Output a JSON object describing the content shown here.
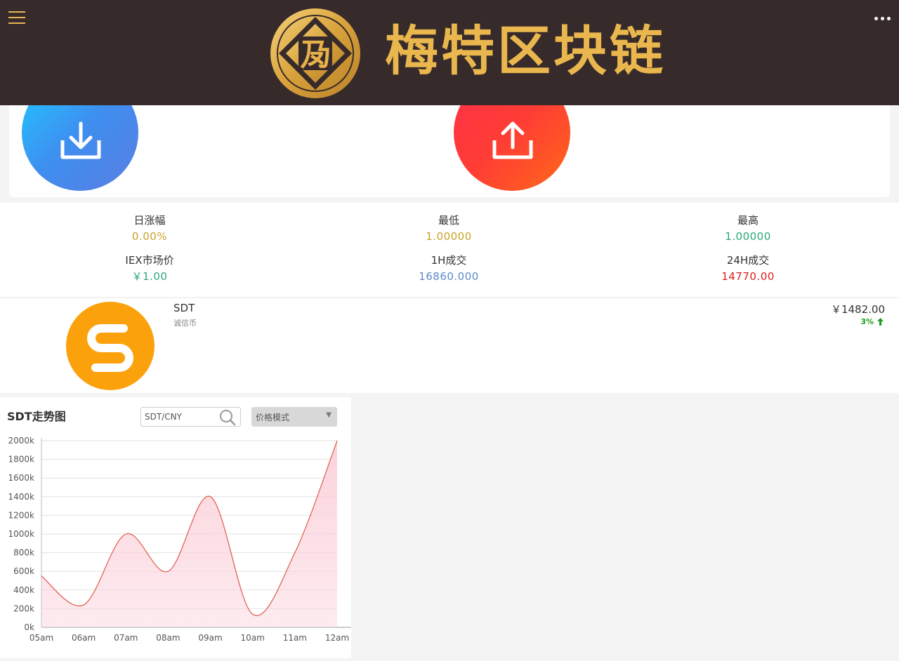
{
  "header": {
    "logo_glyph": "夃",
    "brand": "梅特区块链",
    "menu_icon": "hamburger-icon",
    "more_icon": "more-dots-icon",
    "colors": {
      "bg": "#372a2a",
      "gold": "#eab74e"
    }
  },
  "actions": {
    "deposit_icon": "download-icon",
    "withdraw_icon": "upload-icon"
  },
  "stats": [
    {
      "label": "日涨幅",
      "value": "0.00%",
      "color": "#c9a227"
    },
    {
      "label": "最低",
      "value": "1.00000",
      "color": "#c9a227"
    },
    {
      "label": "最高",
      "value": "1.00000",
      "color": "#2aa878"
    },
    {
      "label": "IEX市场价",
      "value": "￥1.00",
      "color": "#2aa878"
    },
    {
      "label": "1H成交",
      "value": "16860.000",
      "color": "#5b8bc4"
    },
    {
      "label": "24H成交",
      "value": "14770.00",
      "color": "#d81e1e"
    }
  ],
  "coin": {
    "symbol": "SDT",
    "name": "诚信币",
    "price": "￥1482.00",
    "change": "3%",
    "change_icon": "arrow-up-icon",
    "logo_icon": "sdt-coin-icon",
    "logo_color": "#fba10c"
  },
  "chart_panel": {
    "title": "SDT走势图",
    "search_value": "SDT/CNY",
    "search_icon": "search-icon",
    "mode_selected": "价格模式",
    "mode_arrow": "▼"
  },
  "chart_data": {
    "type": "area",
    "x": [
      "05am",
      "06am",
      "07am",
      "08am",
      "09am",
      "10am",
      "11am",
      "12am"
    ],
    "values": [
      550,
      240,
      1000,
      600,
      1400,
      140,
      800,
      2000
    ],
    "ylim": [
      0,
      2000
    ],
    "yticks": [
      0,
      200,
      400,
      600,
      800,
      1000,
      1200,
      1400,
      1600,
      1800,
      2000
    ],
    "ytick_suffix": "k",
    "grid": true,
    "line_color": "#e05a4a",
    "fill_color": "#fbd3dc"
  }
}
